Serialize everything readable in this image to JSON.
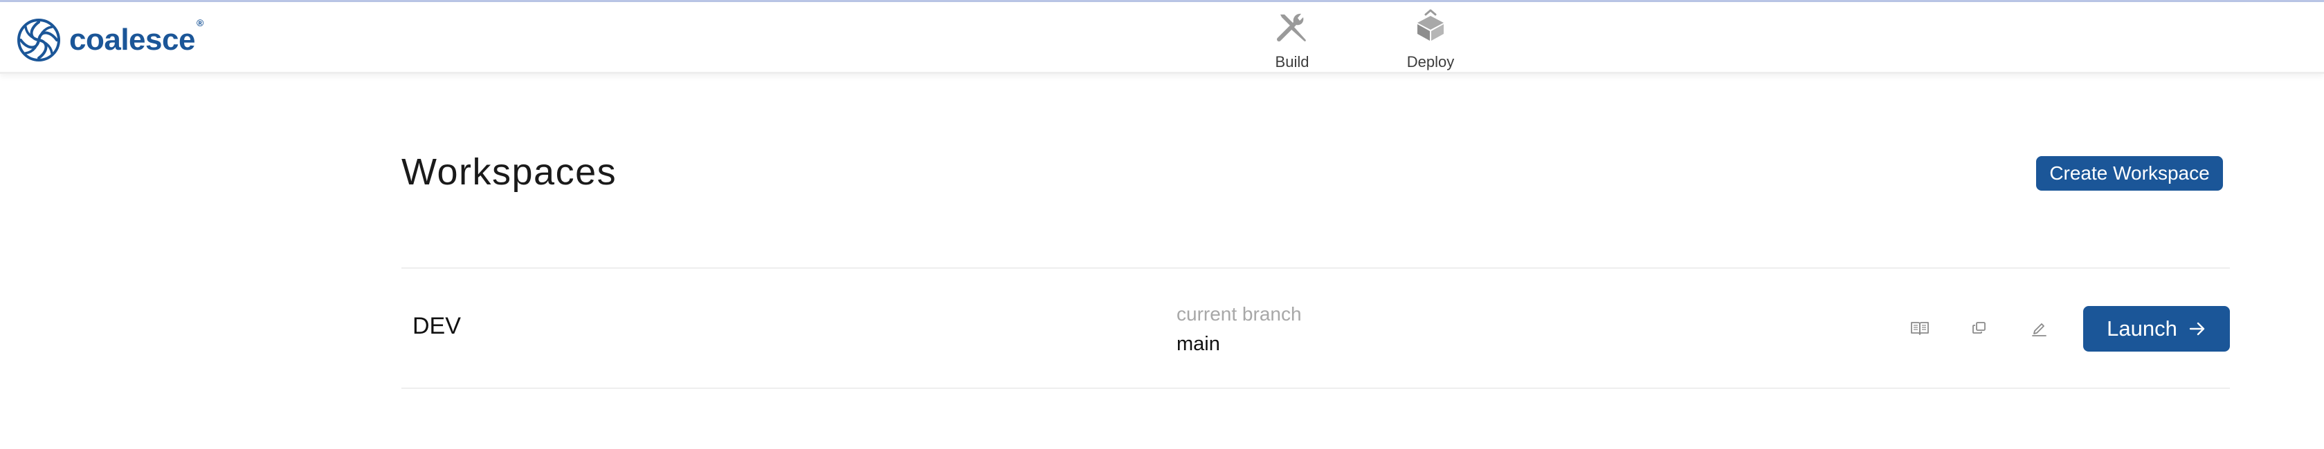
{
  "app": {
    "logo_text": "coalesce",
    "logo_mark": "®"
  },
  "nav": {
    "items": [
      {
        "label": "Build",
        "icon": "tools-icon"
      },
      {
        "label": "Deploy",
        "icon": "deploy-icon"
      }
    ]
  },
  "workspaces": {
    "title": "Workspaces",
    "create_label": "Create Workspace",
    "rows": [
      {
        "name": "DEV",
        "branch_label": "current branch",
        "branch": "main",
        "launch_label": "Launch"
      }
    ]
  },
  "colors": {
    "brand": "#1b5698",
    "muted_text": "#a8a8a8",
    "icon_gray": "#9a9a9a",
    "divider": "#eeeeee"
  }
}
